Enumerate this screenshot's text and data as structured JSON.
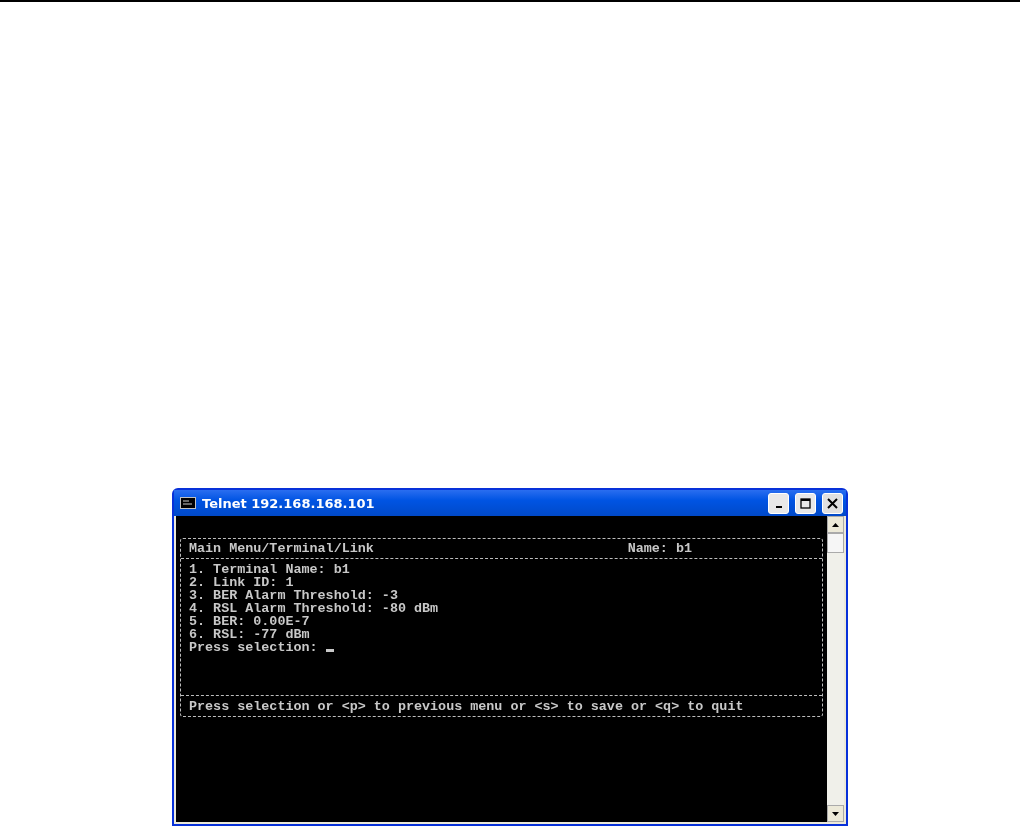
{
  "window": {
    "title": "Telnet 192.168.168.101"
  },
  "terminal": {
    "path": "Main Menu/Terminal/Link",
    "name": "Name: b1",
    "items": [
      "1. Terminal Name: b1",
      "2. Link ID: 1",
      "3. BER Alarm Threshold: -3",
      "4. RSL Alarm Threshold: -80 dBm",
      "5. BER: 0.00E-7",
      "6. RSL: -77 dBm"
    ],
    "prompt": "Press selection:",
    "footer": "Press selection or <p> to previous menu or <s> to save or <q> to quit"
  }
}
